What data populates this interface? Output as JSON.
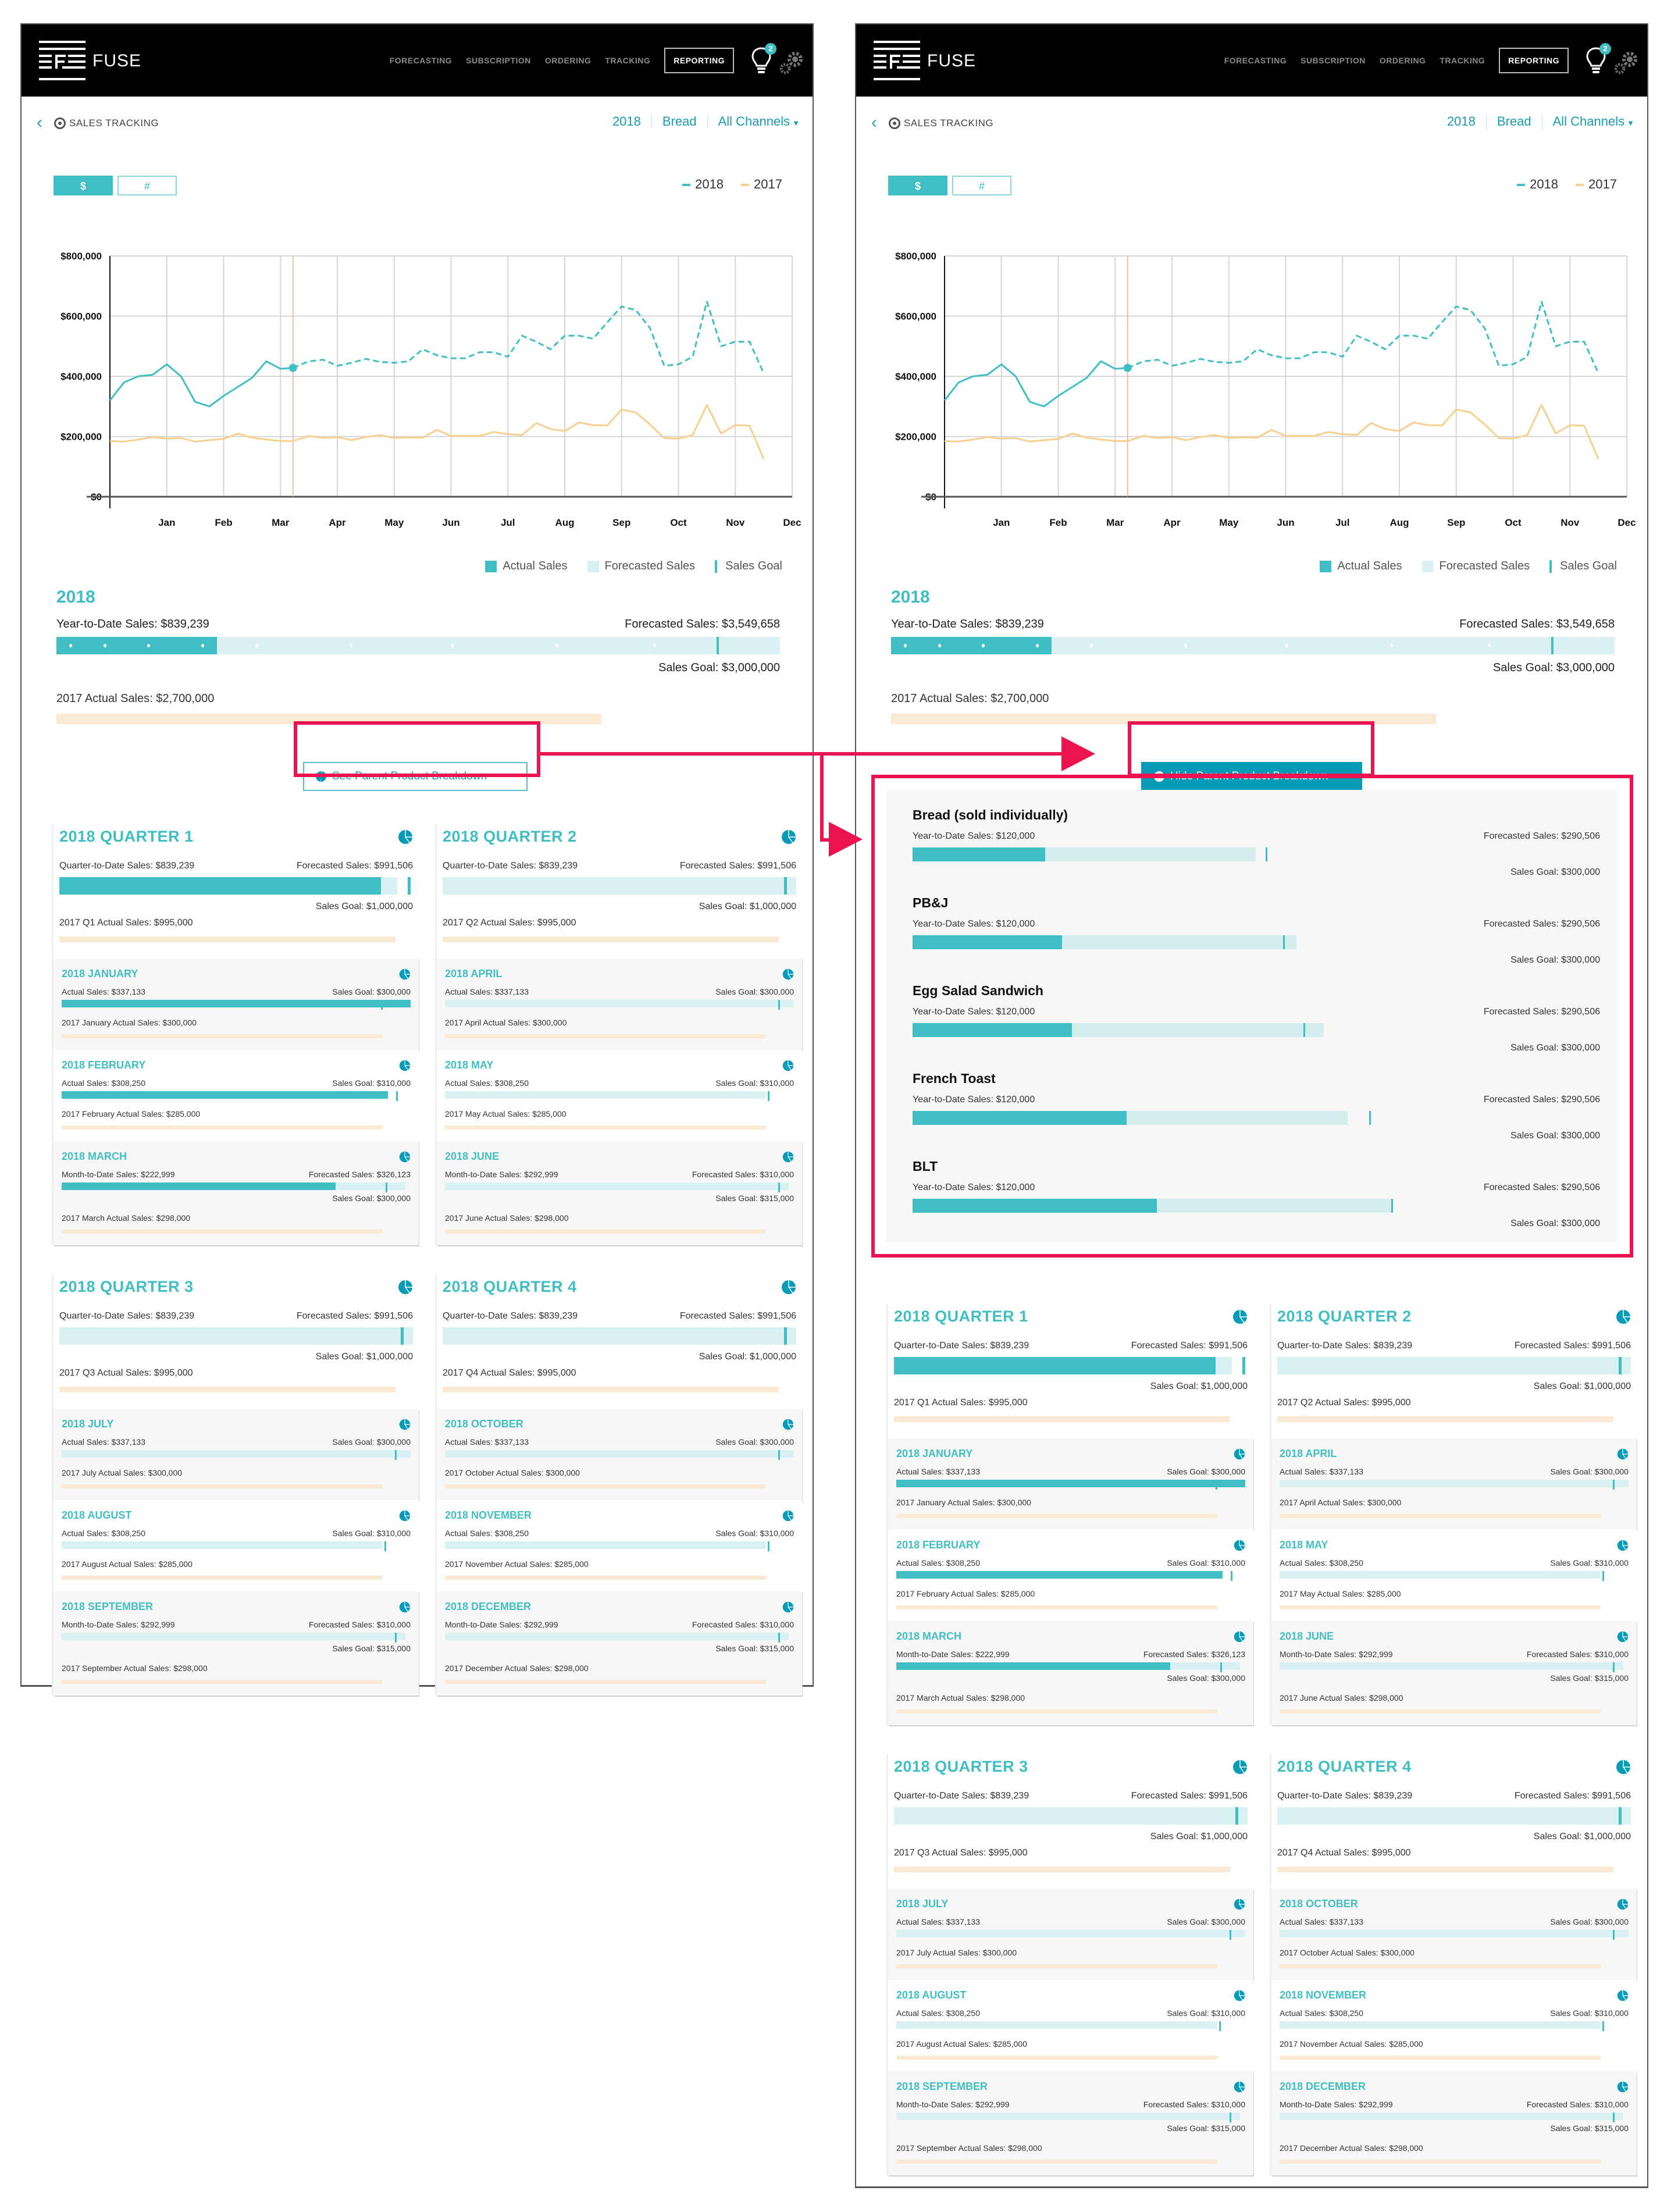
{
  "header": {
    "brand": "FUSE",
    "nav": [
      "FORECASTING",
      "SUBSCRIPTION",
      "ORDERING",
      "TRACKING",
      "REPORTING"
    ],
    "active_nav": "REPORTING",
    "notification_count": "2",
    "icons": [
      "fuse-logo-icon",
      "lightbulb-icon",
      "gear-icon"
    ]
  },
  "subheader": {
    "back_icon": "chevron-left-icon",
    "title_icon": "target-icon",
    "title": "SALES TRACKING",
    "filters": {
      "year": "2018",
      "product": "Bread",
      "channel": "All Channels"
    }
  },
  "toggle": {
    "dollar": "$",
    "count": "#",
    "selected": "$"
  },
  "colors": {
    "accent": "#3fbfc3",
    "dark_accent": "#079bb7",
    "prev_year": "#f8cf8f",
    "forecast_bg": "#d9f1f2",
    "prev_bar": "#fbead3",
    "highlight": "#ec1450"
  },
  "chart_data": {
    "type": "line",
    "title": "",
    "xlabel": "",
    "ylabel": "",
    "ylim": [
      0,
      800000
    ],
    "yticks": [
      0,
      200000,
      400000,
      600000,
      800000
    ],
    "ytick_labels": [
      "$0",
      "$200,000",
      "$400,000",
      "$600,000",
      "$800,000"
    ],
    "x_categories": [
      "Jan",
      "Feb",
      "Mar",
      "Apr",
      "May",
      "Jun",
      "Jul",
      "Aug",
      "Sep",
      "Oct",
      "Nov",
      "Dec"
    ],
    "x_domain": [
      0,
      12
    ],
    "grid": true,
    "legend": [
      "2018",
      "2017"
    ],
    "legend_position": "top-right",
    "current_marker_x": 3.22,
    "series": [
      {
        "name": "2018 (actual)",
        "style": "solid",
        "color": "#3fbfc3",
        "x": [
          0,
          0.25,
          0.5,
          0.75,
          1.0,
          1.25,
          1.5,
          1.75,
          2.0,
          2.25,
          2.5,
          2.75,
          3.0,
          3.22
        ],
        "y": [
          320000,
          380000,
          400000,
          405000,
          440000,
          400000,
          315000,
          300000,
          335000,
          365000,
          395000,
          450000,
          425000,
          428000
        ]
      },
      {
        "name": "2018 (forecast)",
        "style": "dashed",
        "color": "#3fbfc3",
        "x": [
          3.22,
          3.5,
          3.75,
          4.0,
          4.25,
          4.5,
          4.75,
          5.0,
          5.25,
          5.5,
          5.75,
          6.0,
          6.25,
          6.5,
          6.75,
          7.0,
          7.25,
          7.5,
          7.75,
          8.0,
          8.25,
          8.5,
          8.75,
          9.0,
          9.25,
          9.5,
          9.75,
          10.0,
          10.25,
          10.5,
          10.75,
          11.0,
          11.25,
          11.5
        ],
        "y": [
          428000,
          450000,
          455000,
          435000,
          445000,
          458000,
          448000,
          445000,
          450000,
          490000,
          470000,
          460000,
          460000,
          480000,
          480000,
          465000,
          535000,
          515000,
          490000,
          535000,
          535000,
          525000,
          580000,
          632000,
          620000,
          560000,
          435000,
          440000,
          465000,
          648000,
          500000,
          515000,
          515000,
          410000
        ]
      },
      {
        "name": "2017",
        "style": "solid",
        "color": "#f8cf8f",
        "x": [
          0,
          0.25,
          0.5,
          0.75,
          1.0,
          1.25,
          1.5,
          1.75,
          2.0,
          2.25,
          2.5,
          2.75,
          3.0,
          3.22,
          3.5,
          3.75,
          4.0,
          4.25,
          4.5,
          4.75,
          5.0,
          5.25,
          5.5,
          5.75,
          6.0,
          6.25,
          6.5,
          6.75,
          7.0,
          7.25,
          7.5,
          7.75,
          8.0,
          8.25,
          8.5,
          8.75,
          9.0,
          9.25,
          9.5,
          9.75,
          10.0,
          10.25,
          10.5,
          10.75,
          11.0,
          11.25,
          11.5
        ],
        "y": [
          185000,
          183000,
          190000,
          198000,
          193000,
          195000,
          183000,
          188000,
          192000,
          210000,
          196000,
          190000,
          185000,
          185000,
          202000,
          195000,
          198000,
          188000,
          198000,
          205000,
          195000,
          197000,
          196000,
          222000,
          202000,
          202000,
          202000,
          215000,
          208000,
          205000,
          245000,
          225000,
          218000,
          247000,
          238000,
          237000,
          290000,
          280000,
          240000,
          195000,
          193000,
          205000,
          305000,
          210000,
          238000,
          236000,
          125000
        ]
      }
    ]
  },
  "kind_legend": [
    "Actual Sales",
    "Forecasted Sales",
    "Sales Goal"
  ],
  "year_summary": {
    "title": "2018",
    "ytd_label": "Year-to-Date Sales: $839,239",
    "forecast_label": "Forecasted Sales: $3,549,658",
    "goal_label": "Sales Goal: $3,000,000",
    "prev_label": "2017 Actual Sales: $2,700,000",
    "ytd_value": 839239,
    "forecast_value": 3549658,
    "goal_value": 3000000,
    "prev_value": 2700000
  },
  "breakdown": {
    "see_label": "See Parent Product Breakdown",
    "hide_label": "Hide Parent Product Breakdown",
    "products": [
      {
        "name": "Bread (sold individually)",
        "ytd_label": "Year-to-Date Sales: $120,000",
        "forecast_label": "Forecasted Sales: $290,506",
        "goal_label": "Sales Goal: $300,000",
        "ytd_frac": 0.195,
        "forecast_frac": 0.505,
        "goal_frac": 0.52
      },
      {
        "name": "PB&J",
        "ytd_label": "Year-to-Date Sales: $120,000",
        "forecast_label": "Forecasted Sales: $290,506",
        "goal_label": "Sales Goal: $300,000",
        "ytd_frac": 0.22,
        "forecast_frac": 0.565,
        "goal_frac": 0.545
      },
      {
        "name": "Egg Salad Sandwich",
        "ytd_label": "Year-to-Date Sales: $120,000",
        "forecast_label": "Forecasted Sales: $290,506",
        "goal_label": "Sales Goal: $300,000",
        "ytd_frac": 0.235,
        "forecast_frac": 0.605,
        "goal_frac": 0.575
      },
      {
        "name": "French Toast",
        "ytd_label": "Year-to-Date Sales: $120,000",
        "forecast_label": "Forecasted Sales: $290,506",
        "goal_label": "Sales Goal: $300,000",
        "ytd_frac": 0.315,
        "forecast_frac": 0.64,
        "goal_frac": 0.672
      },
      {
        "name": "BLT",
        "ytd_label": "Year-to-Date Sales: $120,000",
        "forecast_label": "Forecasted Sales: $290,506",
        "goal_label": "Sales Goal: $300,000",
        "ytd_frac": 0.36,
        "forecast_frac": 0.705,
        "goal_frac": 0.705
      }
    ]
  },
  "quarters": [
    {
      "title": "2018 QUARTER 1",
      "todate_label": "Quarter-to-Date Sales: $839,239",
      "forecast_label": "Forecasted Sales: $991,506",
      "goal_label": "Sales Goal: $1,000,000",
      "prev_label": "2017 Q1 Actual Sales: $995,000",
      "actual_frac": 0.91,
      "forecast_frac": 0.955,
      "goal_frac": 0.985,
      "months": [
        {
          "title": "2018 JANUARY",
          "left_label": "Actual Sales: $337,133",
          "right_label": "Sales Goal: $300,000",
          "goal_label": "",
          "prev_label": "2017 January Actual Sales: $300,000",
          "actual_frac": 1.0,
          "forecast_frac": 1.0,
          "goal_frac": 0.915
        },
        {
          "title": "2018 FEBRUARY",
          "left_label": "Actual Sales: $308,250",
          "right_label": "Sales Goal: $310,000",
          "goal_label": "",
          "prev_label": "2017 February Actual Sales: $285,000",
          "actual_frac": 0.935,
          "forecast_frac": 0.935,
          "goal_frac": 0.958
        },
        {
          "title": "2018 MARCH",
          "left_label": "Month-to-Date Sales: $222,999",
          "right_label": "Forecasted Sales: $326,123",
          "goal_label": "Sales Goal: $300,000",
          "prev_label": "2017 March Actual Sales: $298,000",
          "actual_frac": 0.785,
          "forecast_frac": 0.985,
          "goal_frac": 0.928
        }
      ]
    },
    {
      "title": "2018 QUARTER 2",
      "todate_label": "Quarter-to-Date Sales: $839,239",
      "forecast_label": "Forecasted Sales: $991,506",
      "goal_label": "Sales Goal: $1,000,000",
      "prev_label": "2017 Q2 Actual Sales: $995,000",
      "actual_frac": 0,
      "forecast_frac": 1.0,
      "goal_frac": 0.965,
      "months": [
        {
          "title": "2018 APRIL",
          "left_label": "Actual Sales: $337,133",
          "right_label": "Sales Goal: $300,000",
          "goal_label": "",
          "prev_label": "2017 April Actual Sales: $300,000",
          "actual_frac": 0,
          "forecast_frac": 1.0,
          "goal_frac": 0.955
        },
        {
          "title": "2018 MAY",
          "left_label": "Actual Sales: $308,250",
          "right_label": "Sales Goal: $310,000",
          "goal_label": "",
          "prev_label": "2017 May Actual Sales: $285,000",
          "actual_frac": 0,
          "forecast_frac": 0.92,
          "goal_frac": 0.925
        },
        {
          "title": "2018 JUNE",
          "left_label": "Month-to-Date Sales: $292,999",
          "right_label": "Forecasted Sales: $310,000",
          "goal_label": "Sales Goal: $315,000",
          "prev_label": "2017 June Actual Sales: $298,000",
          "actual_frac": 0,
          "forecast_frac": 0.985,
          "goal_frac": 0.955
        }
      ]
    },
    {
      "title": "2018 QUARTER 3",
      "todate_label": "Quarter-to-Date Sales: $839,239",
      "forecast_label": "Forecasted Sales: $991,506",
      "goal_label": "Sales Goal: $1,000,000",
      "prev_label": "2017 Q3 Actual Sales: $995,000",
      "actual_frac": 0,
      "forecast_frac": 1.0,
      "goal_frac": 0.965,
      "months": [
        {
          "title": "2018 JULY",
          "left_label": "Actual Sales: $337,133",
          "right_label": "Sales Goal: $300,000",
          "goal_label": "",
          "prev_label": "2017 July Actual Sales: $300,000",
          "actual_frac": 0,
          "forecast_frac": 1.0,
          "goal_frac": 0.955
        },
        {
          "title": "2018 AUGUST",
          "left_label": "Actual Sales: $308,250",
          "right_label": "Sales Goal: $310,000",
          "goal_label": "",
          "prev_label": "2017 August Actual Sales: $285,000",
          "actual_frac": 0,
          "forecast_frac": 0.92,
          "goal_frac": 0.925
        },
        {
          "title": "2018 SEPTEMBER",
          "left_label": "Month-to-Date Sales: $292,999",
          "right_label": "Forecasted Sales: $310,000",
          "goal_label": "Sales Goal: $315,000",
          "prev_label": "2017 September Actual Sales: $298,000",
          "actual_frac": 0,
          "forecast_frac": 0.985,
          "goal_frac": 0.955
        }
      ]
    },
    {
      "title": "2018 QUARTER 4",
      "todate_label": "Quarter-to-Date Sales: $839,239",
      "forecast_label": "Forecasted Sales: $991,506",
      "goal_label": "Sales Goal: $1,000,000",
      "prev_label": "2017 Q4 Actual Sales: $995,000",
      "actual_frac": 0,
      "forecast_frac": 1.0,
      "goal_frac": 0.965,
      "months": [
        {
          "title": "2018 OCTOBER",
          "left_label": "Actual Sales: $337,133",
          "right_label": "Sales Goal: $300,000",
          "goal_label": "",
          "prev_label": "2017 October Actual Sales: $300,000",
          "actual_frac": 0,
          "forecast_frac": 1.0,
          "goal_frac": 0.955
        },
        {
          "title": "2018 NOVEMBER",
          "left_label": "Actual Sales: $308,250",
          "right_label": "Sales Goal: $310,000",
          "goal_label": "",
          "prev_label": "2017 November Actual Sales: $285,000",
          "actual_frac": 0,
          "forecast_frac": 0.92,
          "goal_frac": 0.925
        },
        {
          "title": "2018 DECEMBER",
          "left_label": "Month-to-Date Sales: $292,999",
          "right_label": "Forecasted Sales: $310,000",
          "goal_label": "Sales Goal: $315,000",
          "prev_label": "2017 December Actual Sales: $298,000",
          "actual_frac": 0,
          "forecast_frac": 0.985,
          "goal_frac": 0.955
        }
      ]
    }
  ]
}
